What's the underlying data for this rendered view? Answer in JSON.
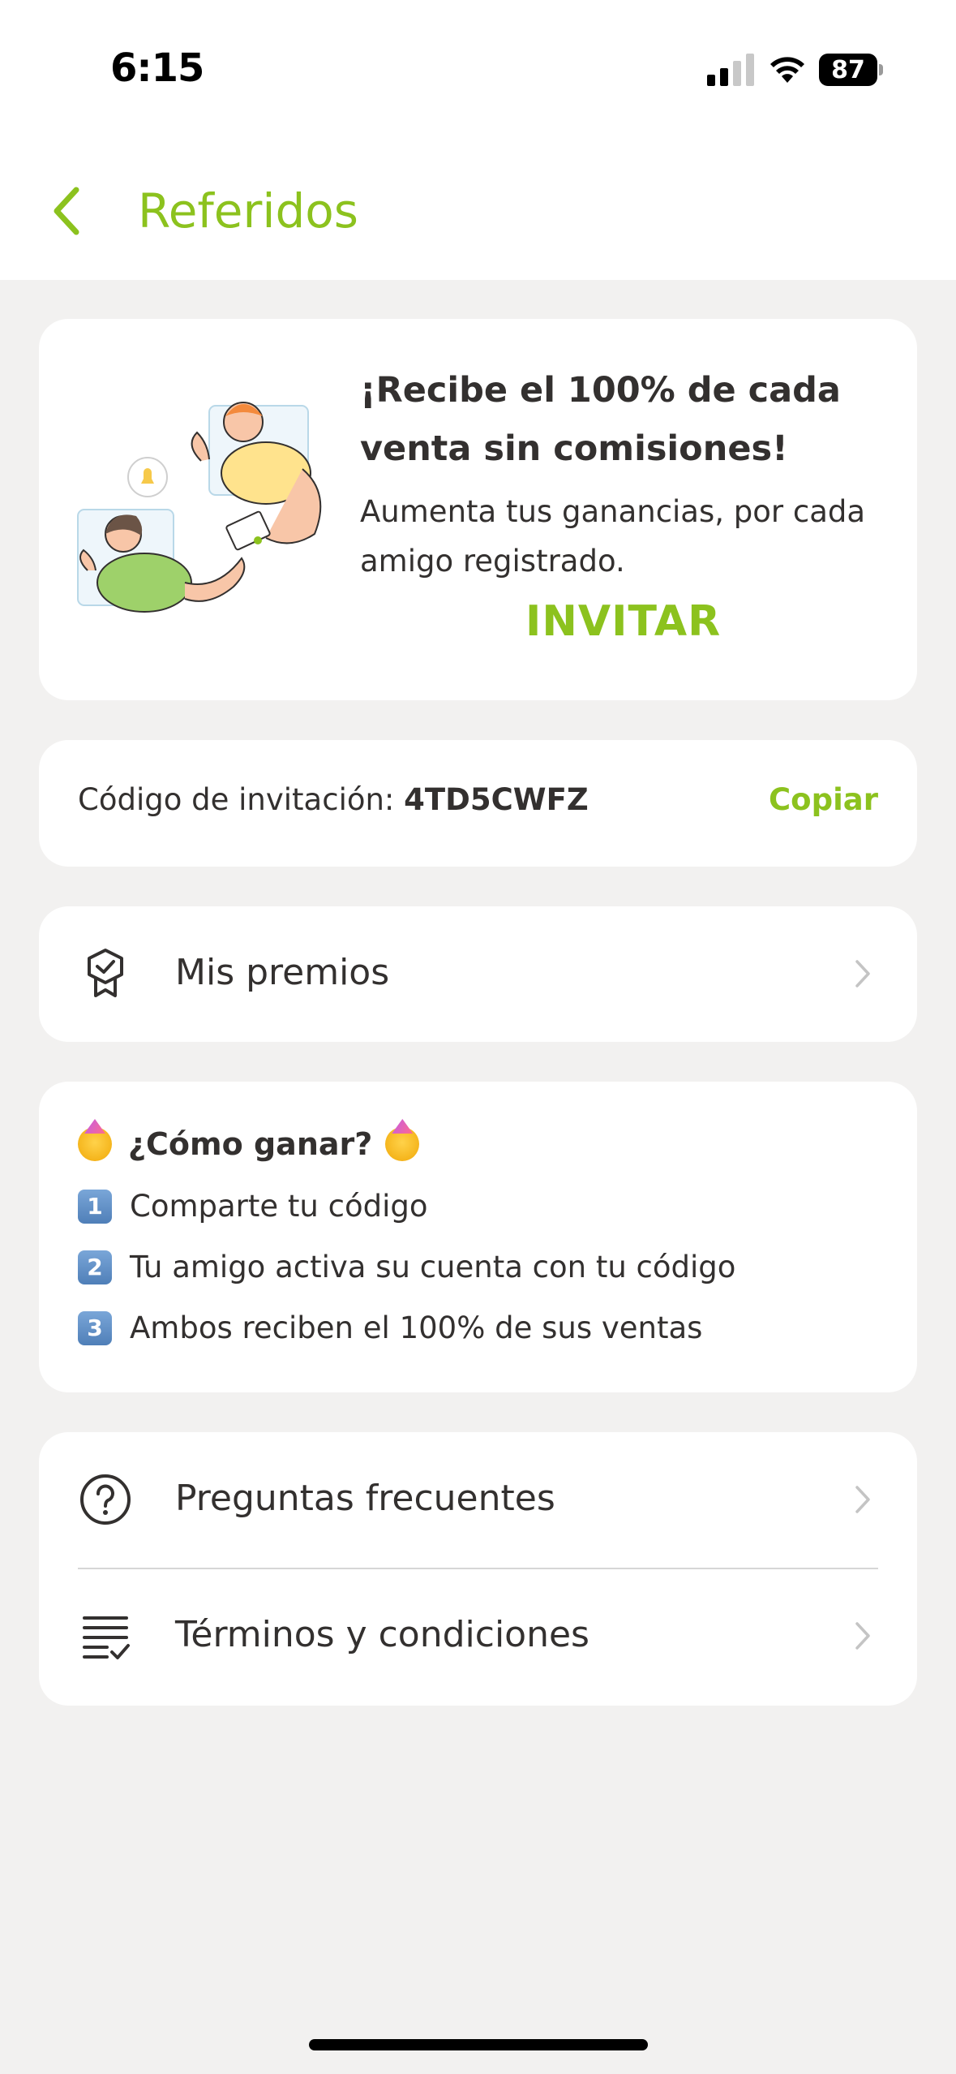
{
  "status_bar": {
    "time": "6:15",
    "battery": "87"
  },
  "header": {
    "title": "Referidos"
  },
  "promo": {
    "title": "¡Recibe el 100% de cada venta sin comisiones!",
    "subtitle": "Aumenta tus ganancias, por cada amigo registrado.",
    "invite_label": "INVITAR"
  },
  "invite_code": {
    "label": "Código de invitación: ",
    "code": "4TD5CWFZ",
    "copy_label": "Copiar"
  },
  "prizes": {
    "label": "Mis premios"
  },
  "how_to": {
    "title": "¿Cómo ganar?",
    "steps": [
      {
        "number": "1",
        "text": "Comparte tu código"
      },
      {
        "number": "2",
        "text": "Tu amigo activa su cuenta con tu código"
      },
      {
        "number": "3",
        "text": "Ambos reciben el 100% de sus ventas"
      }
    ]
  },
  "help": {
    "faq_label": "Preguntas frecuentes",
    "terms_label": "Términos y condiciones"
  },
  "colors": {
    "accent": "#8cc21e",
    "text": "#33302f",
    "background": "#f2f1f0",
    "card": "#ffffff"
  },
  "icons": {
    "back": "chevron-left-icon",
    "prizes": "badge-icon",
    "faq": "question-circle-icon",
    "terms": "checklist-icon",
    "row_chevron": "chevron-right-icon"
  }
}
